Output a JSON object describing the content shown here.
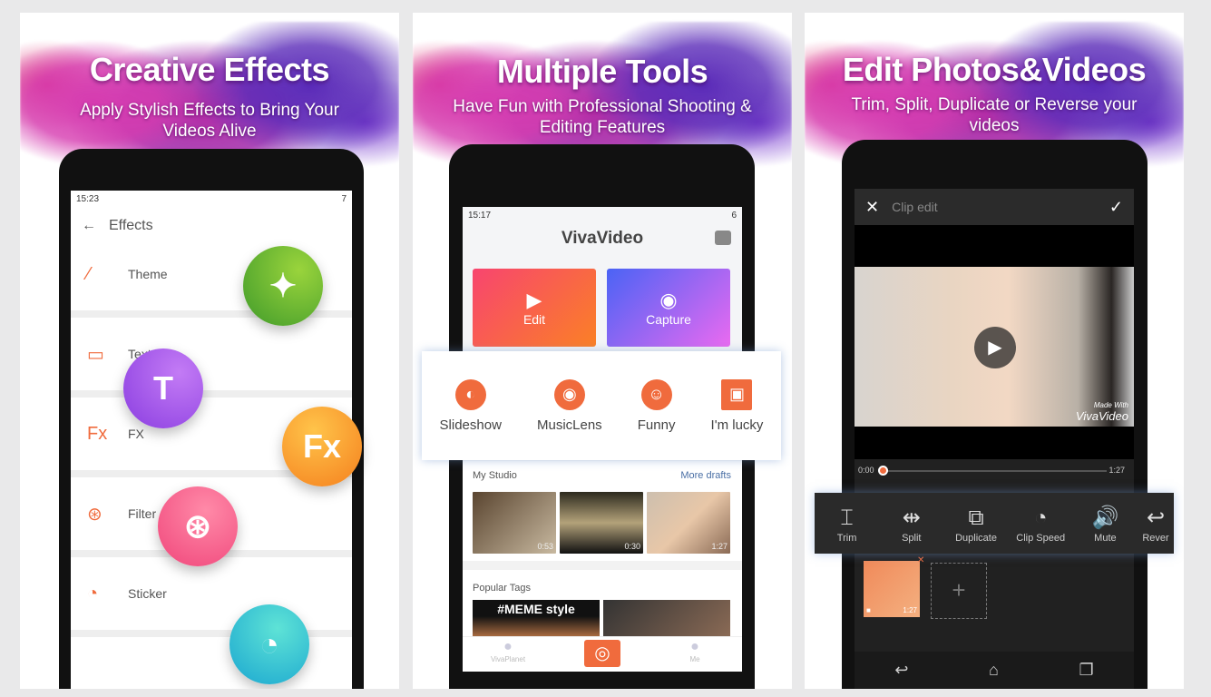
{
  "panels": [
    {
      "title": "Creative Effects",
      "subtitle": "Apply Stylish Effects to Bring Your Videos Alive"
    },
    {
      "title": "Multiple Tools",
      "subtitle": "Have Fun with Professional Shooting & Editing Features"
    },
    {
      "title": "Edit Photos&Videos",
      "subtitle": "Trim, Split, Duplicate or Reverse your videos"
    }
  ],
  "effects_screen": {
    "status_time": "15:23",
    "battery": "7",
    "header": "Effects",
    "items": [
      {
        "label": "Theme",
        "icon": "magic-wand-icon"
      },
      {
        "label": "Text",
        "icon": "text-icon"
      },
      {
        "label": "FX",
        "icon": "fx-icon"
      },
      {
        "label": "Filter",
        "icon": "filter-icon"
      },
      {
        "label": "Sticker",
        "icon": "sticker-icon"
      }
    ],
    "fx_glyph": "Fx",
    "fx_small": "Fx"
  },
  "home_screen": {
    "status_time": "15:17",
    "battery": "6",
    "logo": "VivaVideo",
    "edit_label": "Edit",
    "capture_label": "Capture",
    "tools": [
      {
        "label": "Slideshow"
      },
      {
        "label": "MusicLens"
      },
      {
        "label": "Funny"
      },
      {
        "label": "I'm lucky"
      }
    ],
    "my_studio": "My Studio",
    "more_drafts": "More drafts",
    "drafts": [
      {
        "duration": "0:53"
      },
      {
        "duration": "0:30"
      },
      {
        "duration": "1:27"
      }
    ],
    "popular_tags": "Popular Tags",
    "tags": [
      {
        "label": "#MEME style"
      },
      {
        "label": ""
      }
    ],
    "nav": [
      {
        "label": "VivaPlanet"
      },
      {
        "label": "Me"
      }
    ],
    "accent": "#f06b3d"
  },
  "clip_edit_screen": {
    "title": "Clip edit",
    "watermark_line1": "Made With",
    "watermark_line2": "VivaVideo",
    "time_start": "0:00",
    "time_end": "1:27",
    "progress": 0,
    "tools": [
      {
        "label": "Trim",
        "glyph": "⌶"
      },
      {
        "label": "Split",
        "glyph": "⇹"
      },
      {
        "label": "Duplicate",
        "glyph": "⧉"
      },
      {
        "label": "Clip Speed",
        "glyph": "◔"
      },
      {
        "label": "Mute",
        "glyph": "🔊"
      },
      {
        "label": "Rever",
        "glyph": "↩"
      }
    ],
    "clip_duration": "1:27",
    "add_glyph": "+"
  }
}
